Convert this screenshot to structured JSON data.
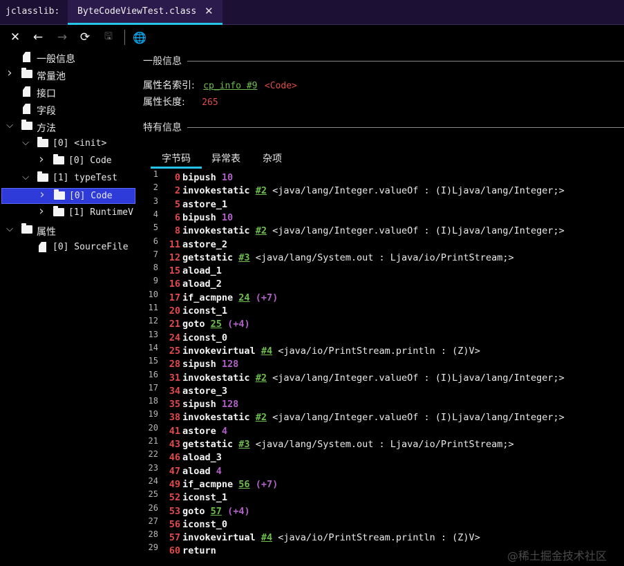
{
  "titlebar": {
    "app_label": "jclasslib:",
    "tab_title": "ByteCodeViewTest.class",
    "close_glyph": "✕"
  },
  "toolbar": {
    "close": "✕",
    "back": "←",
    "forward": "→",
    "reload": "⟳",
    "save": "🖫",
    "web": "🌐"
  },
  "tree": [
    {
      "label": "一般信息",
      "type": "file",
      "level": 0,
      "arrow": ""
    },
    {
      "label": "常量池",
      "type": "folder",
      "level": 0,
      "arrow": "›"
    },
    {
      "label": "接口",
      "type": "file",
      "level": 0,
      "arrow": ""
    },
    {
      "label": "字段",
      "type": "file",
      "level": 0,
      "arrow": ""
    },
    {
      "label": "方法",
      "type": "folder",
      "level": 0,
      "arrow": "⌄"
    },
    {
      "label": "[0] <init>",
      "type": "folder",
      "level": 1,
      "arrow": "⌄"
    },
    {
      "label": "[0] Code",
      "type": "folder",
      "level": 2,
      "arrow": "›"
    },
    {
      "label": "[1] typeTest",
      "type": "folder",
      "level": 1,
      "arrow": "⌄"
    },
    {
      "label": "[0] Code",
      "type": "folder",
      "level": 2,
      "arrow": "›",
      "selected": true
    },
    {
      "label": "[1] RuntimeV",
      "type": "folder",
      "level": 2,
      "arrow": "›"
    },
    {
      "label": "属性",
      "type": "folder",
      "level": 0,
      "arrow": "⌄"
    },
    {
      "label": "[0] SourceFile",
      "type": "file",
      "level": 1,
      "arrow": ""
    }
  ],
  "general": {
    "title": "一般信息",
    "name_index_label": "属性名索引:",
    "name_index_link": "cp_info #9",
    "name_index_value": "<Code>",
    "length_label": "属性长度:",
    "length_value": "265"
  },
  "specific": {
    "title": "特有信息"
  },
  "tabs": [
    "字节码",
    "异常表",
    "杂项"
  ],
  "code": [
    {
      "ln": "1",
      "off": "0",
      "op": "bipush",
      "num": "10"
    },
    {
      "ln": "2",
      "off": "2",
      "op": "invokestatic",
      "cp": "#2",
      "cmt": "<java/lang/Integer.valueOf : (I)Ljava/lang/Integer;>"
    },
    {
      "ln": "3",
      "off": "5",
      "op": "astore_1"
    },
    {
      "ln": "4",
      "off": "6",
      "op": "bipush",
      "num": "10"
    },
    {
      "ln": "5",
      "off": "8",
      "op": "invokestatic",
      "cp": "#2",
      "cmt": "<java/lang/Integer.valueOf : (I)Ljava/lang/Integer;>"
    },
    {
      "ln": "6",
      "off": "11",
      "op": "astore_2"
    },
    {
      "ln": "7",
      "off": "12",
      "op": "getstatic",
      "cp": "#3",
      "cmt": "<java/lang/System.out : Ljava/io/PrintStream;>"
    },
    {
      "ln": "8",
      "off": "15",
      "op": "aload_1"
    },
    {
      "ln": "9",
      "off": "16",
      "op": "aload_2"
    },
    {
      "ln": "10",
      "off": "17",
      "op": "if_acmpne",
      "cp": "24",
      "num": "(+7)"
    },
    {
      "ln": "11",
      "off": "20",
      "op": "iconst_1"
    },
    {
      "ln": "12",
      "off": "21",
      "op": "goto",
      "cp": "25",
      "num": "(+4)"
    },
    {
      "ln": "13",
      "off": "24",
      "op": "iconst_0"
    },
    {
      "ln": "14",
      "off": "25",
      "op": "invokevirtual",
      "cp": "#4",
      "cmt": "<java/io/PrintStream.println : (Z)V>"
    },
    {
      "ln": "15",
      "off": "28",
      "op": "sipush",
      "num": "128"
    },
    {
      "ln": "16",
      "off": "31",
      "op": "invokestatic",
      "cp": "#2",
      "cmt": "<java/lang/Integer.valueOf : (I)Ljava/lang/Integer;>"
    },
    {
      "ln": "17",
      "off": "34",
      "op": "astore_3"
    },
    {
      "ln": "18",
      "off": "35",
      "op": "sipush",
      "num": "128"
    },
    {
      "ln": "19",
      "off": "38",
      "op": "invokestatic",
      "cp": "#2",
      "cmt": "<java/lang/Integer.valueOf : (I)Ljava/lang/Integer;>"
    },
    {
      "ln": "20",
      "off": "41",
      "op": "astore",
      "num": "4"
    },
    {
      "ln": "21",
      "off": "43",
      "op": "getstatic",
      "cp": "#3",
      "cmt": "<java/lang/System.out : Ljava/io/PrintStream;>"
    },
    {
      "ln": "22",
      "off": "46",
      "op": "aload_3"
    },
    {
      "ln": "23",
      "off": "47",
      "op": "aload",
      "num": "4"
    },
    {
      "ln": "24",
      "off": "49",
      "op": "if_acmpne",
      "cp": "56",
      "num": "(+7)"
    },
    {
      "ln": "25",
      "off": "52",
      "op": "iconst_1"
    },
    {
      "ln": "26",
      "off": "53",
      "op": "goto",
      "cp": "57",
      "num": "(+4)"
    },
    {
      "ln": "27",
      "off": "56",
      "op": "iconst_0"
    },
    {
      "ln": "28",
      "off": "57",
      "op": "invokevirtual",
      "cp": "#4",
      "cmt": "<java/io/PrintStream.println : (Z)V>"
    },
    {
      "ln": "29",
      "off": "60",
      "op": "return"
    }
  ],
  "watermark": "@稀土掘金技术社区"
}
